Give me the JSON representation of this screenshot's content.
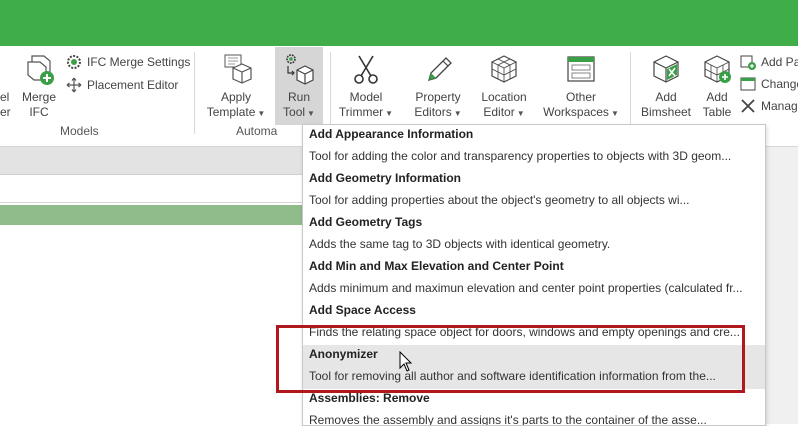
{
  "ribbon": {
    "models_group": {
      "label": "Models",
      "partial_left_top": "el",
      "partial_left_bottom": "er",
      "merge_ifc": [
        "Merge",
        "IFC"
      ],
      "ifc_merge_settings": "IFC Merge Settings",
      "placement_editor": "Placement Editor"
    },
    "automation_group": {
      "label": "Automa",
      "apply_template": [
        "Apply",
        "Template"
      ],
      "run_tool": [
        "Run",
        "Tool"
      ]
    },
    "tools": {
      "model_trimmer": [
        "Model",
        "Trimmer"
      ],
      "property_editors": [
        "Property",
        "Editors"
      ],
      "location_editor": [
        "Location",
        "Editor"
      ],
      "other_workspaces": [
        "Other",
        "Workspaces"
      ]
    },
    "bimsheet": {
      "add_bimsheet": [
        "Add",
        "Bimsheet"
      ],
      "add_table": [
        "Add",
        "Table"
      ],
      "add_pa": "Add Pa",
      "change": "Change",
      "manag": "Manag"
    }
  },
  "dropdown": {
    "items": [
      {
        "title": "Add Appearance Information",
        "desc": "Tool for adding the color and transparency properties to objects with 3D geom..."
      },
      {
        "title": "Add Geometry Information",
        "desc": "Tool for adding properties about the object's geometry to all objects wi..."
      },
      {
        "title": "Add Geometry Tags",
        "desc": "Adds the same tag to 3D objects with identical geometry."
      },
      {
        "title": "Add Min and Max Elevation and Center Point",
        "desc": "Adds minimum and maximun elevation and center point properties (calculated fr..."
      },
      {
        "title": "Add Space Access",
        "desc": "Finds the relating space object for doors, windows and empty openings and cre..."
      },
      {
        "title": "Anonymizer",
        "desc": "Tool for removing all author and software identification information from the..."
      },
      {
        "title": "Assemblies: Remove",
        "desc": "Removes the assembly and assigns it's parts to the container of the asse..."
      }
    ]
  },
  "colors": {
    "title_green": "#3fae49",
    "highlight_red": "#b0181d",
    "row_green": "#8fbc8a"
  }
}
